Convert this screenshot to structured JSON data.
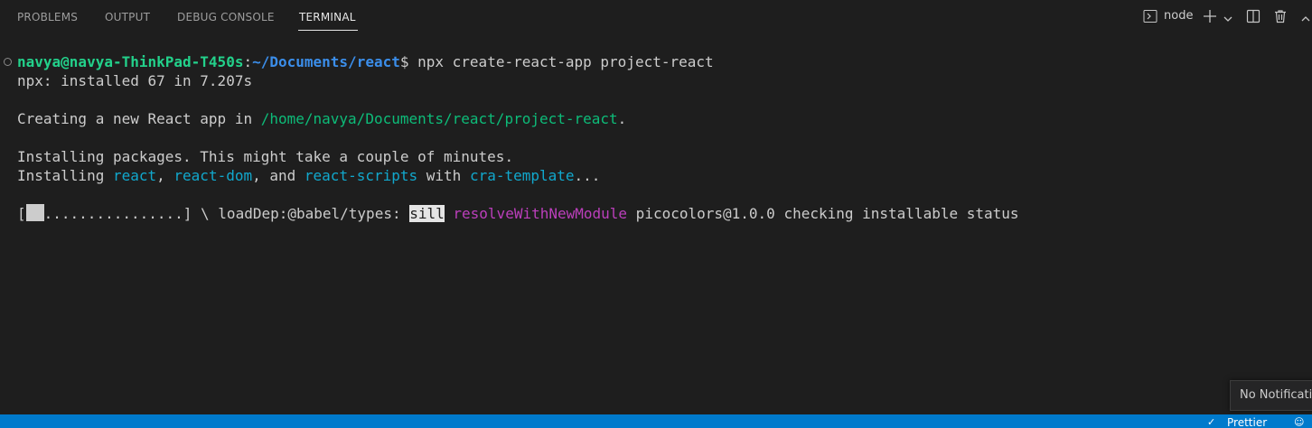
{
  "panel": {
    "tabs": [
      "PROBLEMS",
      "OUTPUT",
      "DEBUG CONSOLE",
      "TERMINAL"
    ],
    "active_tab": "TERMINAL"
  },
  "toolbar": {
    "terminal_name": "node",
    "icons": [
      "terminal-icon",
      "plus-icon",
      "chevron-down-icon",
      "split-icon",
      "trash-icon",
      "chevron-up-icon"
    ]
  },
  "terminal": {
    "prompt_user_host": "navya@navya-ThinkPad-T450s",
    "prompt_colon": ":",
    "prompt_path": "~/Documents/react",
    "prompt_symbol": "$ ",
    "command": "npx create-react-app project-react",
    "line_installed": "npx: installed 67 in 7.207s",
    "creating_prefix": "Creating a new React app in ",
    "creating_path": "/home/navya/Documents/react/project-react",
    "creating_suffix": ".",
    "installing_packages": "Installing packages. This might take a couple of minutes.",
    "installing_prefix": "Installing ",
    "pkg_react": "react",
    "sep1": ", ",
    "pkg_react_dom": "react-dom",
    "sep2": ", and ",
    "pkg_react_scripts": "react-scripts",
    "with_text": " with ",
    "pkg_template": "cra-template",
    "ellipsis": "...",
    "progress_open": "[",
    "progress_dots": "................",
    "progress_close": "] \\ loadDep:@babel/types: ",
    "progress_level": "sill",
    "progress_fn": "resolveWithNewModule",
    "progress_rest": " picocolors@1.0.0 checking installable status"
  },
  "toast": {
    "text": "No Notifications"
  },
  "statusbar": {
    "prettier": "Prettier"
  },
  "colors": {
    "background": "#1e1e1e",
    "statusbar": "#007acc",
    "prompt_green": "#23d18b",
    "prompt_blue": "#3b8eea",
    "path_green": "#0dbc79",
    "package_cyan": "#11a8cd",
    "npm_magenta": "#bc3fbc"
  }
}
